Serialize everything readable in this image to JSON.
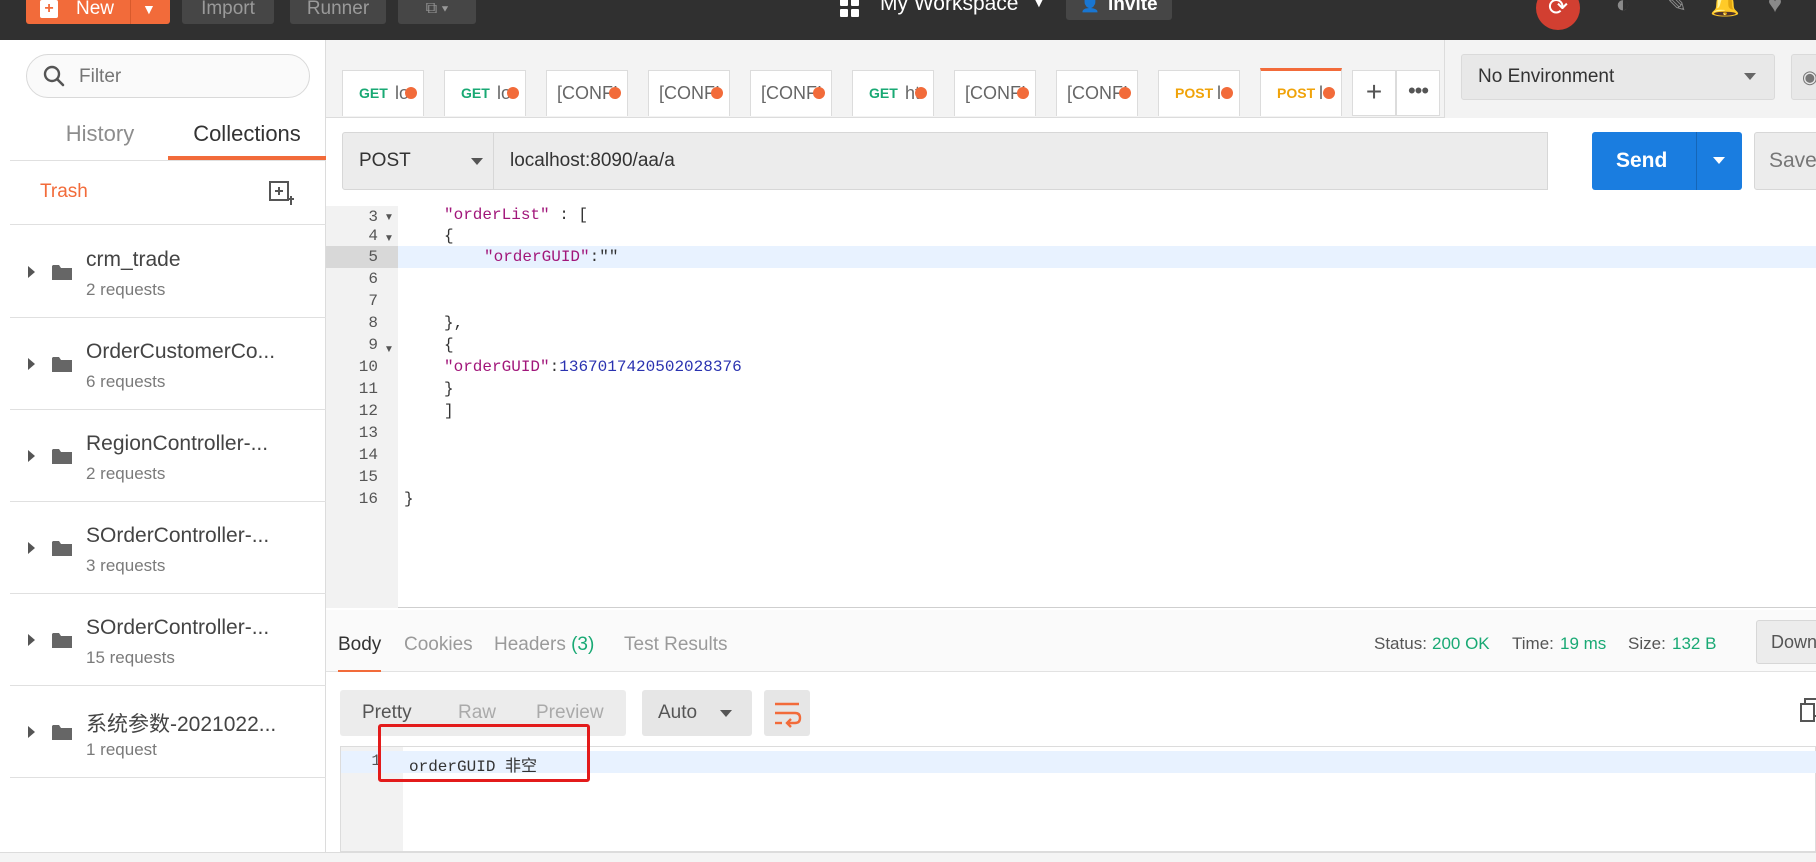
{
  "topbar": {
    "new_label": "New",
    "import_label": "Import",
    "runner_label": "Runner",
    "workspace_label": "My Workspace",
    "invite_label": "Invite"
  },
  "sidebar": {
    "filter_placeholder": "Filter",
    "tabs": {
      "history": "History",
      "collections": "Collections"
    },
    "trash_label": "Trash",
    "collections": [
      {
        "name": "crm_trade",
        "count": "2 requests"
      },
      {
        "name": "OrderCustomerCo...",
        "count": "6 requests"
      },
      {
        "name": "RegionController-...",
        "count": "2 requests"
      },
      {
        "name": "SOrderController-...",
        "count": "3 requests"
      },
      {
        "name": "SOrderController-...",
        "count": "15 requests"
      },
      {
        "name": "系统参数-2021022...",
        "count": "1 request"
      }
    ]
  },
  "request_tabs": [
    {
      "method": "GET",
      "text": "lo"
    },
    {
      "method": "GET",
      "text": "lo"
    },
    {
      "method": "",
      "text": "[CONFI"
    },
    {
      "method": "",
      "text": "[CONFI"
    },
    {
      "method": "",
      "text": "[CONFI"
    },
    {
      "method": "GET",
      "text": "ht"
    },
    {
      "method": "",
      "text": "[CONFI"
    },
    {
      "method": "",
      "text": "[CONFI"
    },
    {
      "method": "POST",
      "text": "l"
    },
    {
      "method": "POST",
      "text": "l"
    }
  ],
  "environment": {
    "selected": "No Environment"
  },
  "request": {
    "method": "POST",
    "url": "localhost:8090/aa/a",
    "send_label": "Send",
    "save_label": "Save"
  },
  "editor": {
    "line_numbers": [
      "3",
      "4",
      "5",
      "6",
      "7",
      "8",
      "9",
      "10",
      "11",
      "12",
      "13",
      "14",
      "15",
      "16"
    ],
    "lines": {
      "l3_key": "\"orderList\"",
      "l3_rest": " : [",
      "l4": "{",
      "l5_key": "\"orderGUID\"",
      "l5_rest": ":\"\"",
      "l8": "},",
      "l9": "{",
      "l10_key": "\"orderGUID\"",
      "l10_colon": ":",
      "l10_val": "1367017420502028376",
      "l11": "}",
      "l12": "]",
      "l16": "}"
    }
  },
  "response": {
    "tabs": {
      "body": "Body",
      "cookies": "Cookies",
      "headers": "Headers",
      "headers_count": "(3)",
      "tests": "Test Results"
    },
    "status_label": "Status:",
    "status_value": "200 OK",
    "time_label": "Time:",
    "time_value": "19 ms",
    "size_label": "Size:",
    "size_value": "132 B",
    "download_label": "Down",
    "formats": {
      "pretty": "Pretty",
      "raw": "Raw",
      "preview": "Preview"
    },
    "language": "Auto",
    "line_number": "1",
    "body_text": "orderGUID 非空"
  },
  "colors": {
    "accent": "#f26b3a",
    "send": "#1a7de0",
    "status_ok": "#19a974",
    "highlight_box": "#e31b1b"
  }
}
